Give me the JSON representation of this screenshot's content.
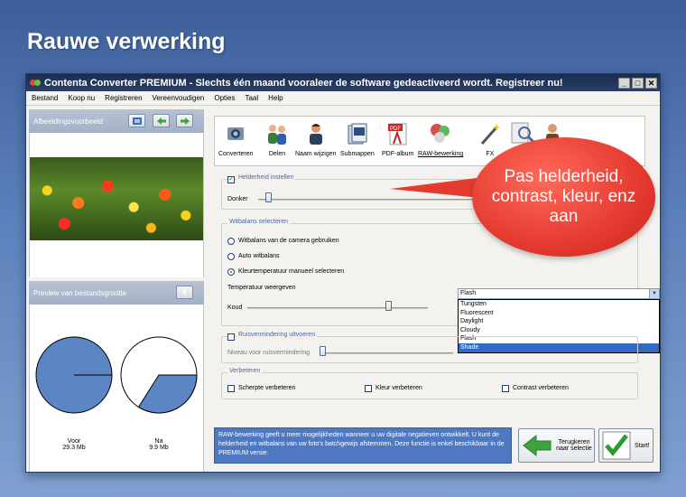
{
  "slide": {
    "title": "Rauwe verwerking"
  },
  "window": {
    "title": "Contenta Converter PREMIUM  - Slechts één maand vooraleer de software gedeactiveerd wordt. Registreer nu!",
    "controls": {
      "minimize": "_",
      "maximize": "□",
      "close": "✕"
    }
  },
  "menu": [
    "Bestand",
    "Koop nu",
    "Registreren",
    "Vereenvoudigen",
    "Opties",
    "Taal",
    "Help"
  ],
  "left_panel": {
    "preview_header": "Afbeeldingsvoorbeeld",
    "size_header": "Preview van bestandsgrootte",
    "pause_button": "⏸",
    "before_label": "Voor",
    "before_size": "29.3 Mb",
    "before_fraction": 1.0,
    "after_label": "Na",
    "after_size": "9.9 Mb",
    "after_fraction": 0.34
  },
  "toolbar": {
    "items": [
      "Converteren",
      "Delen",
      "Naam wijzigen",
      "Submappen",
      "PDF-album",
      "RAW-bewerking",
      "FX"
    ],
    "active": "RAW-bewerking",
    "pdf_badge": "PDF"
  },
  "brightness": {
    "checkbox_label": "Helderheid instellen",
    "checked": true,
    "left_label": "Donker"
  },
  "whitebalance": {
    "title": "Witbalans selecteren",
    "options": [
      "Witbalans van de camera gebruiken",
      "Auto witbalans",
      "Kleurtemperatuur manueel selecteren"
    ],
    "selected_index": 2,
    "temp_label": "Temperatuur weergeven",
    "temp_value": "Flash",
    "temp_options": [
      "Tungsten",
      "Fluorescent",
      "Daylight",
      "Cloudy",
      "Flash",
      "Shade"
    ],
    "highlighted_option": "Shade",
    "slider_label": "Koud"
  },
  "noise": {
    "checkbox_label": "Ruisvermindering uitvoeren",
    "checked": false,
    "level_label": "Niveau voor ruisvermindering"
  },
  "improve": {
    "title": "Verbeteren",
    "options": [
      "Scherpte verbeteren",
      "Kleur verbeteren",
      "Contrast verbeteren"
    ]
  },
  "info_text": "RAW-bewerking geeft u meer mogelijkheden wanneer u uw digitale negatieven ontwikkelt. U kunt de helderheid en witbalans van uw foto's batchgewijs afstemmen. Deze functie is enkel beschikbaar in de PREMIUM versie.",
  "buttons": {
    "back": "Terugkeren naar selectie",
    "start": "Start!"
  },
  "callout": "Pas helderheid, contrast, kleur, enz aan",
  "colors": {
    "pie_fill": "#5b86c3",
    "callout": "#e53a30",
    "accent": "#4f78c2"
  }
}
